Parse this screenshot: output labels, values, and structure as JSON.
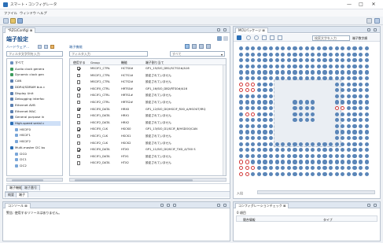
{
  "window": {
    "title": "スマート・コンフィグレータ",
    "controls": {
      "minimize": "—",
      "maximize": "□",
      "close": "✕"
    }
  },
  "menu": [
    "ファイル",
    "ウィンドウ",
    "ヘルプ"
  ],
  "left_panel": {
    "tab_label": "*RZG(Config) ⊠",
    "title": "端子設定",
    "sub_tree_label": "ハードウェア...",
    "sub_table_label": "端子機能",
    "tree_filter_placeholder": "フィルタ文字列を入力",
    "table_filter_placeholder": "フィルタ入力",
    "select_value": "すべて",
    "tree_items": [
      "すべて",
      "Audio clock genera",
      "Dynamic clock gen",
      "CAN",
      "DDR4/SDRAM bus c",
      "Display Unit",
      "Debugging interfac",
      "Ethernet AVB",
      "Ethernet MAC",
      "General purpose in",
      "High-speed serial c",
      "HSCIF0",
      "HSCIF1",
      "HSCIF2",
      "Multi-master I2C bu",
      "I2C0",
      "I2C1",
      "I2C2"
    ],
    "table_headers": [
      "使用する",
      "Group",
      "機能",
      "端子割り当て"
    ],
    "table_rows": [
      {
        "checked": true,
        "group": "MSCIF2_CTRL",
        "func": "HCTS0#",
        "assign": "GP1_15/SIO_DB1/SCT02#/A16"
      },
      {
        "checked": false,
        "group": "MSCIF2_CTRL",
        "func": "HCTS1#",
        "assign": "設定されていません"
      },
      {
        "checked": false,
        "group": "MSCIF2_CTRL",
        "func": "HCTS2#",
        "assign": "設定されていません"
      },
      {
        "checked": true,
        "group": "HSCIF0_CTRL",
        "func": "HRTS0#",
        "assign": "GP1_16/SIO_DB2/RTS0#/A16"
      },
      {
        "checked": false,
        "group": "HSCIF1_CTRL",
        "func": "HRTS1#",
        "assign": "設定されていません"
      },
      {
        "checked": false,
        "group": "HSCIF2_CTRL",
        "func": "HRTS2#",
        "assign": "設定されていません"
      },
      {
        "checked": true,
        "group": "HSCIF0_DATA",
        "func": "HRX0",
        "assign": "GP1_12/SIO_D0/HSCIF_RX0_A/HSOUT/IRQ"
      },
      {
        "checked": false,
        "group": "HSCIF1_DATA",
        "func": "HRX1",
        "assign": "設定されていません"
      },
      {
        "checked": false,
        "group": "HSCIF2_DATA",
        "func": "HRX2",
        "assign": "設定されていません"
      },
      {
        "checked": true,
        "group": "HSCIF0_CLK",
        "func": "HSCK0",
        "assign": "GP1_13/SIO_D1/SCIF_B/HSDO0/CAN"
      },
      {
        "checked": false,
        "group": "HSCIF1_CLK",
        "func": "HSCK1",
        "assign": "設定されていません"
      },
      {
        "checked": false,
        "group": "HSCIF2_CLK",
        "func": "HSCK2",
        "assign": "設定されていません"
      },
      {
        "checked": true,
        "group": "HSCIF0_DATA",
        "func": "HTX0",
        "assign": "GP1_11/SIO_D0/SCIF_TXD_A/TX0 S"
      },
      {
        "checked": false,
        "group": "HSCIF1_DATA",
        "func": "HTX1",
        "assign": "設定されていません"
      },
      {
        "checked": false,
        "group": "HSCIF2_DATA",
        "func": "HTX2",
        "assign": "設定されていません"
      }
    ],
    "bottom_tabs": [
      "端子機能",
      "端子番号"
    ],
    "bottom_subtabs": [
      "概要",
      "端子"
    ]
  },
  "right_panel": {
    "tab_label": "MCUパッケージ ⊠",
    "search_placeholder": "検索文字を入力",
    "search_option": "端子数字順",
    "footer_label": "入出"
  },
  "bottom_left": {
    "tab_label": "コンソール ⊠",
    "message": "警告: 使用するリソースはありません。"
  },
  "bottom_right": {
    "tab_label": "コンフィグレーションチェック ⊠",
    "count_label": "0 項目",
    "columns": [
      "競合情報",
      "タイプ"
    ]
  },
  "colors": {
    "accent": "#2b6fb6",
    "pin": "#5b86b8",
    "pin_conflict": "#d23a3a"
  }
}
